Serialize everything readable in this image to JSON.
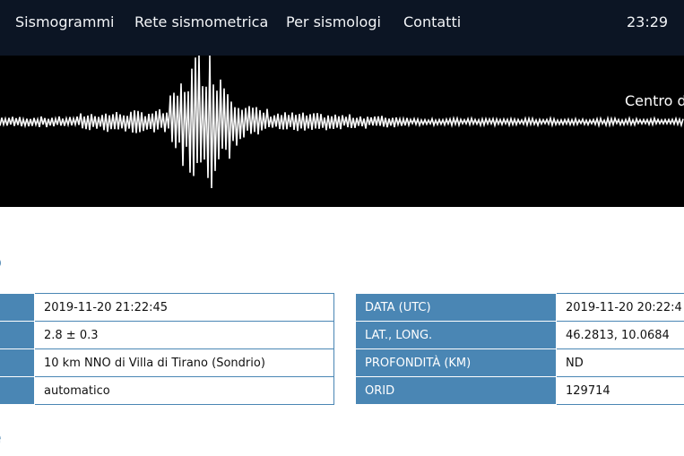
{
  "nav": {
    "items": [
      "Sismogrammi",
      "Rete sismometrica",
      "Per sismologi",
      "Contatti"
    ],
    "clock": "23:29"
  },
  "hero": {
    "title": "Centro d"
  },
  "section1": {
    "heading": "o"
  },
  "section2": {
    "heading": "e"
  },
  "left_table": {
    "rows": [
      {
        "label": "",
        "value": "2019-11-20 21:22:45"
      },
      {
        "label": "",
        "value": "2.8 ± 0.3"
      },
      {
        "label": "",
        "value": "10 km NNO di Villa di Tirano (Sondrio)"
      },
      {
        "label": "",
        "value": "automatico"
      }
    ]
  },
  "right_table": {
    "rows": [
      {
        "label": "DATA (UTC)",
        "value": "2019-11-20 20:22:4"
      },
      {
        "label": "LAT., LONG.",
        "value": "46.2813, 10.0684"
      },
      {
        "label": "PROFONDITÀ (KM)",
        "value": "ND"
      },
      {
        "label": "ORID",
        "value": "129714"
      }
    ]
  },
  "colors": {
    "navbar": "#0c1524",
    "accent": "#4a86b4",
    "heading": "#4a84b0"
  }
}
